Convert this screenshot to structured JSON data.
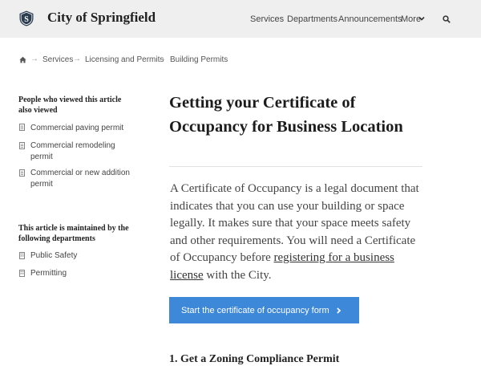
{
  "header": {
    "site_title": "City of Springfield",
    "logo_letter": "S",
    "nav": {
      "services": "Services",
      "departments": "Departments",
      "announcements": "Announcements",
      "more": "More"
    },
    "icons": {
      "more": "chevron-down-icon",
      "search": "search-icon",
      "logo": "shield-logo-icon"
    }
  },
  "breadcrumb": {
    "home_icon": "home-icon",
    "items": [
      "Services",
      "Licensing and Permits",
      "Building Permits"
    ],
    "separator": "→"
  },
  "sidebar": {
    "viewed_heading": "People who viewed this article also viewed",
    "viewed_items": [
      "Commercial paving permit",
      "Commercial remodeling permit",
      "Commercial or new addition permit"
    ],
    "maintained_heading": "This article is maintained by the following departments",
    "departments": [
      "Public Safety",
      "Permitting"
    ]
  },
  "article": {
    "title": "Getting your Certificate of Occupancy for Business Location",
    "body_before_link": "A Certificate of Occupancy is a legal document that indicates that you can use your building or space legally. It makes sure that your space meets safety and other requirements. You will need a Certificate of Occupancy before ",
    "body_link": "registering for a business license",
    "body_after_link": " with the City.",
    "cta_label": "Start the certificate of occupancy form",
    "section_heading": "1. Get a Zoning Compliance Permit"
  },
  "colors": {
    "header_bg": "#efefef",
    "cta_bg": "#3d88d8",
    "logo_bg": "#2c3e50"
  }
}
